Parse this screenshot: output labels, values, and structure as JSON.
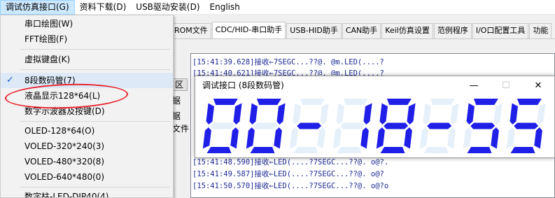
{
  "menubar": {
    "items": [
      "调试仿真接口(G)",
      "资料下载(D)",
      "USB驱动安装(D)",
      "English"
    ]
  },
  "tabs": [
    "ROM文件",
    "CDC/HID-串口助手",
    "USB-HID助手",
    "CAN助手",
    "Keil仿真设置",
    "范例程序",
    "I/O口配置工具",
    "功能"
  ],
  "side_fragments": [
    "区",
    "据",
    "据",
    "文件"
  ],
  "log_lines": [
    "[15:41:39.628]接收←7SEGC...??@. @m.LED(....?",
    "[15:41:40.621]接收←7SEGC...??@. @m.LED(....?",
    "[15:41:48.590]接收←LED(....?7SEGC...??@. o@?.",
    "[15:41:49.587]接收←LED(....?7SEGC...??@. o@?",
    "[15:41:50.570]接收←LED(....?7SEGC...??@. o@?o"
  ],
  "dropdown": {
    "items": [
      "串口绘图(W)",
      "FFT绘图(F)",
      "虚拟键盘(K)",
      "8段数码管(7)",
      "液晶显示128*64(L)",
      "数字示波器及按键(D)",
      "OLED-128*64(O)",
      "VOLED-320*240(3)",
      "VOLED-480*320(8)",
      "VOLED-640*480(0)",
      "数字柱-LED-DIP40(4)"
    ],
    "checked_index": 3,
    "check_glyph": "✓"
  },
  "popup": {
    "title": "调试接口 (8段数码管)",
    "minimize": "—",
    "maximize": "☐",
    "close": "✕",
    "segment_text": "00-18-55",
    "digits": [
      "0",
      "0",
      "-",
      "1",
      "8",
      "-",
      "5",
      "5"
    ]
  },
  "colors": {
    "segment_on": "#1f1fe8",
    "segment_off": "#e6f0fb",
    "log_text": "#1e2a96",
    "highlight_oval": "#e8202a",
    "menu_active": "#cce8ff"
  },
  "icons": [
    "check-icon",
    "minimize-icon",
    "maximize-icon",
    "close-icon"
  ]
}
